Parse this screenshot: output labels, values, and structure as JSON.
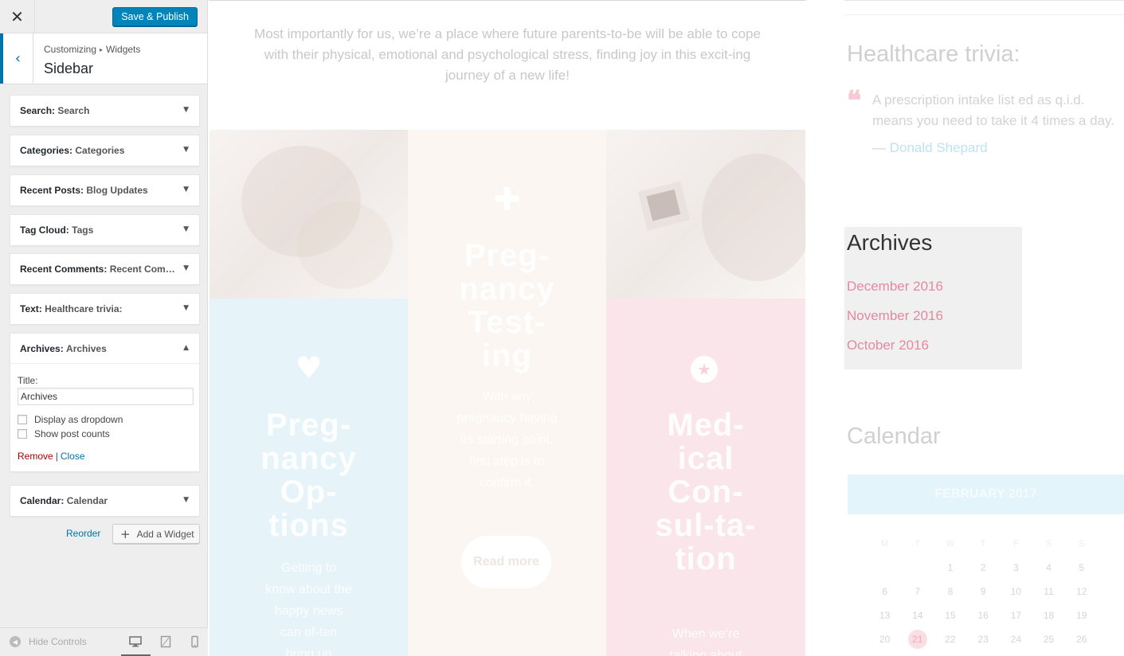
{
  "customizer": {
    "close_glyph": "✕",
    "save_label": "Save & Publish",
    "back_glyph": "‹",
    "breadcrumb": {
      "root": "Customizing",
      "separator": "▸",
      "leaf": "Widgets"
    },
    "section_title": "Sidebar",
    "widgets": [
      {
        "type": "Search",
        "title": "Search",
        "state": "collapsed"
      },
      {
        "type": "Categories",
        "title": "Categories",
        "state": "collapsed"
      },
      {
        "type": "Recent Posts",
        "title": "Blog Updates",
        "state": "collapsed"
      },
      {
        "type": "Tag Cloud",
        "title": "Tags",
        "state": "collapsed"
      },
      {
        "type": "Recent Comments",
        "title": "Recent Com…",
        "state": "collapsed"
      },
      {
        "type": "Text",
        "title": "Healthcare trivia:",
        "state": "collapsed"
      },
      {
        "type": "Archives",
        "title": "Archives",
        "state": "expanded"
      },
      {
        "type": "Calendar",
        "title": "Calendar",
        "state": "collapsed"
      }
    ],
    "collapsed_arrow": "▼",
    "expanded_arrow": "▲",
    "archives_form": {
      "title_label": "Title:",
      "title_value": "Archives",
      "dropdown_label": "Display as dropdown",
      "dropdown_checked": false,
      "counts_label": "Show post counts",
      "counts_checked": false,
      "remove_label": "Remove",
      "pipe": "|",
      "close_label": "Close"
    },
    "reorder_label": "Reorder",
    "add_widget_plus": "+",
    "add_widget_label": "Add a Widget",
    "hide_controls_label": "Hide Controls",
    "hide_controls_glyph": "◀",
    "devices": [
      "desktop",
      "tablet",
      "mobile"
    ],
    "active_device": "desktop"
  },
  "preview": {
    "intro_text": "Most importantly for us, we’re a place where future parents-to-be will be able to cope with their physical, emotional and psychological stress, finding joy in this excit-ing journey of a new life!",
    "columns": [
      {
        "color": "#e6f3f9",
        "icon": "♥",
        "title": "Preg-nancy Op-tions",
        "text": "Getting to know about the happy news can of-ten bring up"
      },
      {
        "color": "#fbf6f1",
        "icon": "✚",
        "title": "Preg-nancy Test-ing",
        "text": "With any pregnancy having its starting point, first step is to confirm it.",
        "button": "Read more"
      },
      {
        "color": "#fae6ea",
        "icon": "★",
        "title": "Med-ical Con-sul-ta-tion",
        "text": "When we’re talking about"
      }
    ],
    "trivia": {
      "title": "Healthcare trivia:",
      "quote_mark": "❝",
      "quote": "A prescription intake list ed as q.i.d. means you need to take it 4 times a day.",
      "author_dash": "— ",
      "author": "Donald Shepard"
    },
    "archives": {
      "title": "Archives",
      "links": [
        "December 2016",
        "November 2016",
        "October 2016"
      ]
    },
    "calendar": {
      "title": "Calendar",
      "month": "FEBRUARY 2017",
      "weekdays": [
        "M",
        "T",
        "W",
        "T",
        "F",
        "S",
        "S"
      ],
      "weeks": [
        [
          "",
          "",
          "1",
          "2",
          "3",
          "4",
          "5"
        ],
        [
          "6",
          "7",
          "8",
          "9",
          "10",
          "11",
          "12"
        ],
        [
          "13",
          "14",
          "15",
          "16",
          "17",
          "18",
          "19"
        ],
        [
          "20",
          "21",
          "22",
          "23",
          "24",
          "25",
          "26"
        ]
      ],
      "today": "21"
    }
  }
}
